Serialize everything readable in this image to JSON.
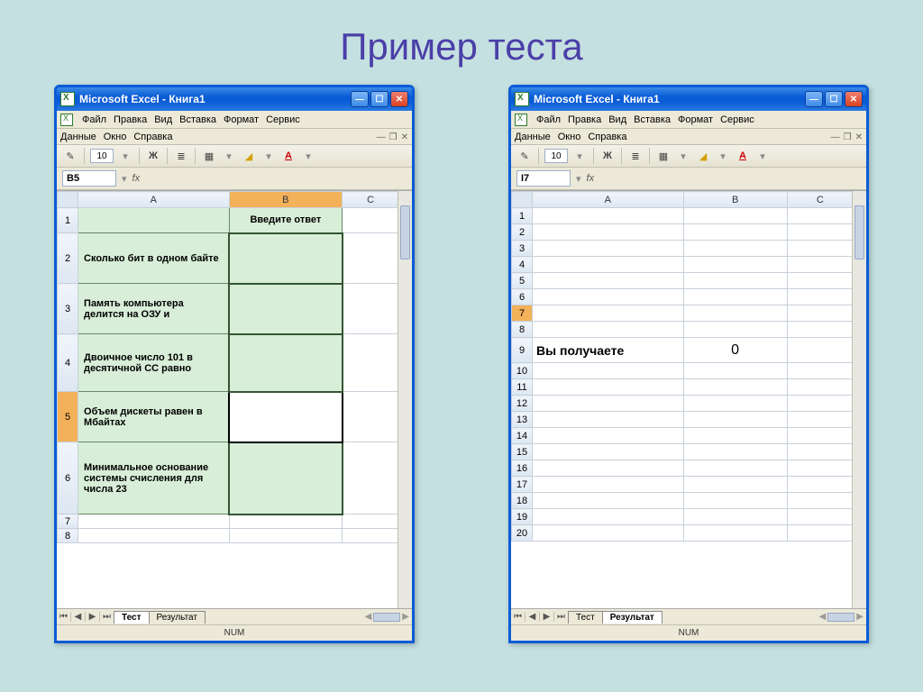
{
  "slide": {
    "title": "Пример теста"
  },
  "left": {
    "title": "Microsoft Excel - Книга1",
    "menu": [
      "Файл",
      "Правка",
      "Вид",
      "Вставка",
      "Формат",
      "Сервис",
      "Данные",
      "Окно",
      "Справка"
    ],
    "font_size": "10",
    "name_box": "B5",
    "columns": [
      "A",
      "B",
      "C"
    ],
    "active_column": "B",
    "active_row": "5",
    "answer_header": "Введите ответ",
    "questions": [
      "Сколько бит в одном байте",
      "Память компьютера делится на ОЗУ и",
      "Двоичное число 101 в десятичной СС равно",
      "Объем дискеты равен в Мбайтах",
      "Минимальное основание системы счисления для числа 23"
    ],
    "tabs": [
      "Тест",
      "Результат"
    ],
    "active_tab": "Тест",
    "status": "NUM"
  },
  "right": {
    "title": "Microsoft Excel - Книга1",
    "menu": [
      "Файл",
      "Правка",
      "Вид",
      "Вставка",
      "Формат",
      "Сервис",
      "Данные",
      "Окно",
      "Справка"
    ],
    "font_size": "10",
    "name_box": "I7",
    "columns": [
      "A",
      "B",
      "C"
    ],
    "row_count": 20,
    "active_row": "7",
    "result_label_row": 9,
    "result_label": "Вы получаете",
    "result_value": "0",
    "tabs": [
      "Тест",
      "Результат"
    ],
    "active_tab": "Результат",
    "status": "NUM"
  }
}
